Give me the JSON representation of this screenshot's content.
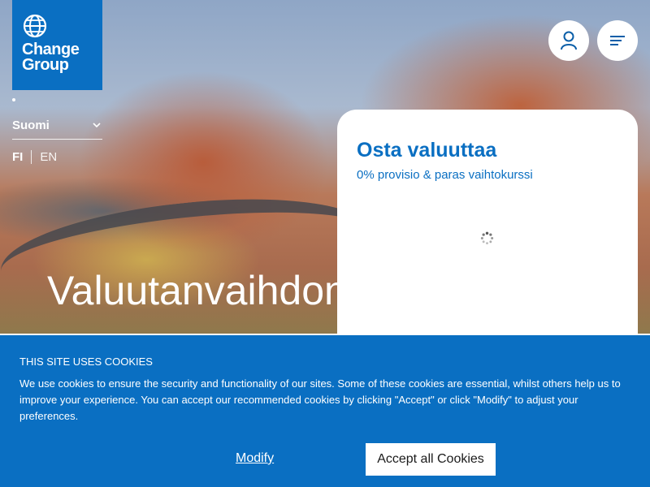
{
  "brand": {
    "logo_text": "Change Group",
    "logo_line1": "Change",
    "logo_line2": "Group",
    "brand_color": "#0a6fc2"
  },
  "country_select": {
    "selected": "Suomi"
  },
  "language_toggle": {
    "active": "FI",
    "other": "EN"
  },
  "header_icons": {
    "account": "account-icon",
    "menu": "menu-icon"
  },
  "hero": {
    "headline": "Valuutanvaihdon asiantuntijasi"
  },
  "buy_card": {
    "title": "Osta valuuttaa",
    "subtitle": "0% provisio & paras vaihtokurssi"
  },
  "cookie_banner": {
    "heading": "THIS SITE USES COOKIES",
    "body": "We use cookies to ensure the security and functionality of our sites. Some of these cookies are essential, whilst others help us to improve your experience. You can accept our recommended cookies by clicking \"Accept\" or click \"Modify\" to adjust your preferences.",
    "modify_label": "Modify",
    "accept_label": "Accept all Cookies"
  }
}
